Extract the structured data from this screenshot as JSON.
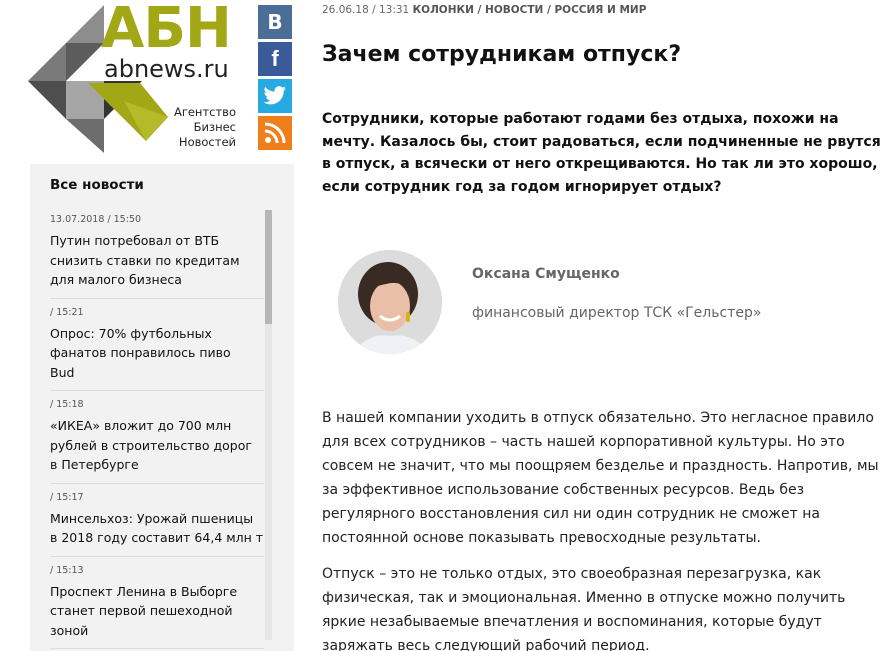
{
  "logo": {
    "main": "АБН",
    "domain": "abnews.ru",
    "tagline": [
      "Агентство",
      "Бизнес",
      "Новостей"
    ],
    "colors": {
      "olive": "#a2a716",
      "gray": "#6d6d6d"
    }
  },
  "social": [
    {
      "name": "vk-icon",
      "glyph": "В",
      "color": "#4b6e97"
    },
    {
      "name": "facebook-icon",
      "glyph": "f",
      "color": "#3b5a9a"
    },
    {
      "name": "twitter-icon",
      "glyph": "twitter",
      "color": "#27a9e1"
    },
    {
      "name": "rss-icon",
      "glyph": "rss",
      "color": "#ef7f1a"
    }
  ],
  "sidebar": {
    "title": "Все новости",
    "items": [
      {
        "time": "13.07.2018 / 15:50",
        "text": [
          "Путин потребовал от ВТБ",
          "снизить ставки по кредитам",
          "для малого бизнеса"
        ]
      },
      {
        "time": "/ 15:21",
        "text": [
          "Опрос: 70% футбольных",
          "фанатов понравилось пиво",
          "Bud"
        ]
      },
      {
        "time": "/ 15:18",
        "text": [
          "«ИКЕА» вложит до 700 млн",
          "рублей в строительство дорог",
          "в Петербурге"
        ]
      },
      {
        "time": "/ 15:17",
        "text": [
          "Минсельхоз: Урожай пшеницы",
          "в 2018 году составит 64,4 млн т"
        ]
      },
      {
        "time": "/ 15:13",
        "text": [
          "Проспект Ленина в Выборге",
          "станет первой пешеходной",
          "зоной"
        ]
      }
    ]
  },
  "article": {
    "date": "26.06.18 / 13:31",
    "categories": "КОЛОНКИ / НОВОСТИ / РОССИЯ И МИР",
    "title": "Зачем сотрудникам отпуск?",
    "lead": "Сотрудники, которые работают годами без отдыха, похожи на мечту. Казалось бы, стоит радоваться, если подчиненные не рвутся в отпуск, а всячески от него открещиваются. Но так ли это хорошо, если сотрудник год за годом игнорирует отдых?",
    "author": {
      "name": "Оксана Смущенко",
      "role": "финансовый директор ТСК «Гельстер»"
    },
    "paragraphs": [
      "В нашей компании уходить в отпуск обязательно. Это негласное правило для всех сотрудников – часть нашей корпоративной культуры. Но это совсем не значит, что мы поощряем безделье и праздность. Напротив, мы за эффективное использование собственных ресурсов. Ведь без регулярного восстановления сил ни один сотрудник не сможет на постоянной основе показывать превосходные результаты.",
      "Отпуск – это не только отдых, это своеобразная перезагрузка, как физическая, так и эмоциональная. Именно в отпуске можно получить яркие незабываемые впечатления и воспоминания, которые будут заряжать весь следующий рабочий период."
    ]
  }
}
